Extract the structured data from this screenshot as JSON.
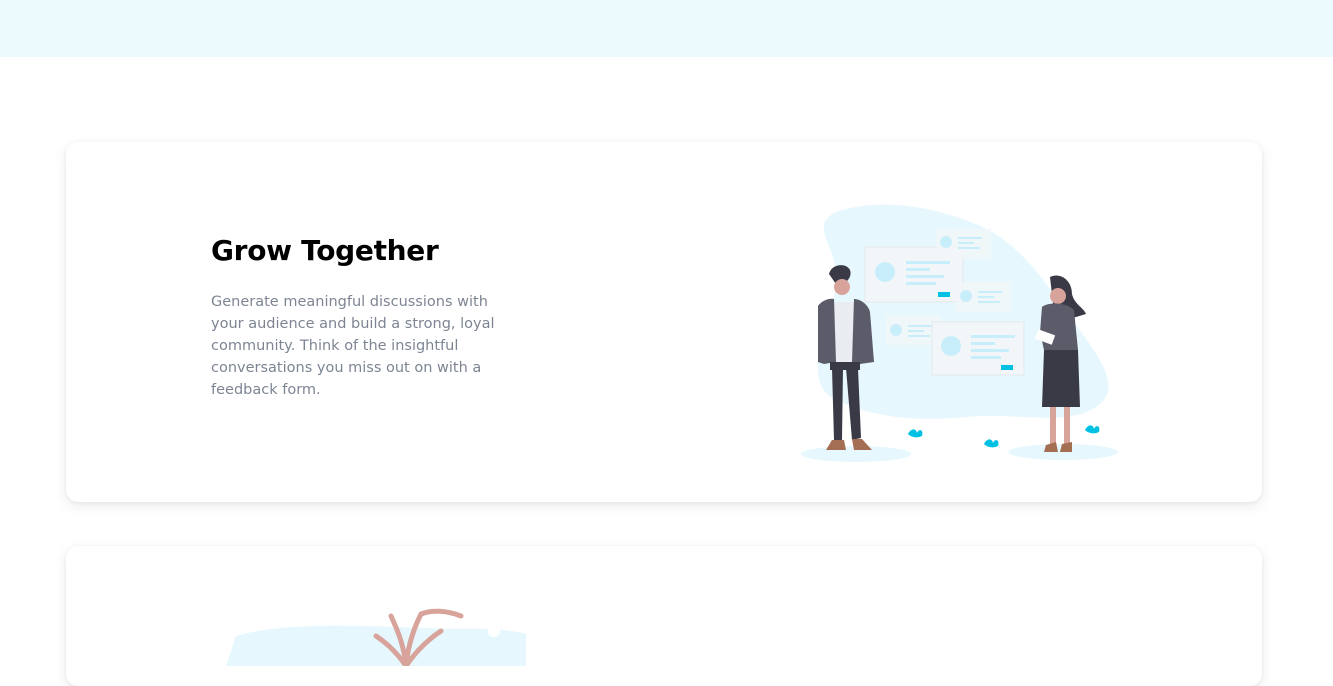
{
  "header": {},
  "features": [
    {
      "title": "Grow Together",
      "description": "Generate meaningful discussions with your audience and build a strong, loyal community. Think of the insightful conversations you miss out on with a feedback form.",
      "illustration": "two-people-discussion-illustration"
    },
    {
      "illustration": "tree-illustration"
    }
  ],
  "colors": {
    "top_band": "#ecfafe",
    "accent": "#00c1e3",
    "blob": "#e6f8fe",
    "text_muted": "#7d8593",
    "heading": "#000000"
  }
}
